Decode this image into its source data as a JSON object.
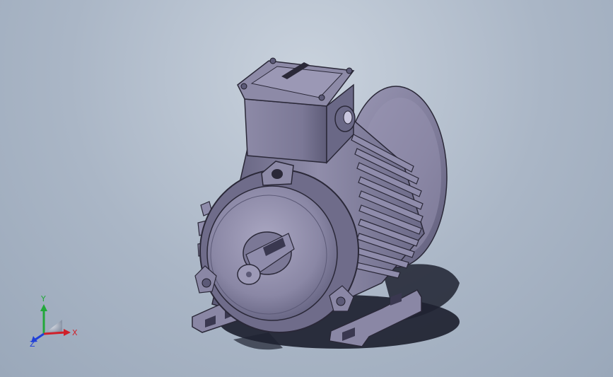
{
  "viewport": {
    "background_top": "#c9d2dd",
    "background_bottom": "#9aa8ba"
  },
  "model": {
    "body_color": "#7f7c9a",
    "shadow_color": "#1e2230"
  },
  "triad": {
    "x_label": "X",
    "y_label": "Y",
    "z_label": "Z",
    "x_color": "#d0202a",
    "y_color": "#22a83a",
    "z_color": "#2040d8"
  }
}
